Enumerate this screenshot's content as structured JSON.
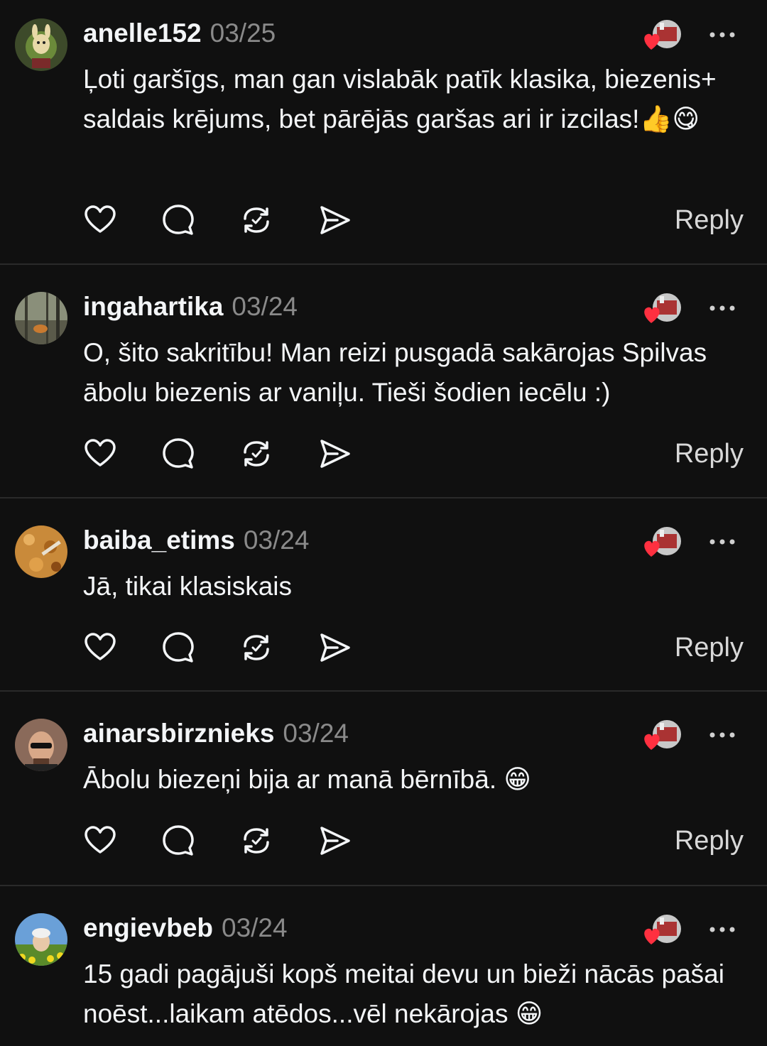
{
  "comments": [
    {
      "username": "anelle152",
      "date": "03/25",
      "text": "Ļoti garšīgs, man gan vislabāk patīk klasika, biezenis+ saldais krējums, bet pārējās garšas ari ir izcilas!👍😋",
      "avatar": "cartoon-character-avatar"
    },
    {
      "username": "ingahartika",
      "date": "03/24",
      "text": "O, šito sakritību! Man reizi pusgadā sakārojas Spilvas ābolu biezenis ar vaniļu. Tieši šodien iecēlu :)",
      "avatar": "forest-photo-avatar"
    },
    {
      "username": "baiba_etims",
      "date": "03/24",
      "text": "Jā, tikai klasiskais",
      "avatar": "pie-photo-avatar"
    },
    {
      "username": "ainarsbirznieks",
      "date": "03/24",
      "text": "Ābolu biezeņi bija ar manā bērnībā. 😁",
      "avatar": "man-sunglasses-avatar"
    },
    {
      "username": "engievbeb",
      "date": "03/24",
      "text": "15 gadi pagājuši kopš meitai devu un bieži nācās pašai noēst...laikam atēdos...vēl nekārojas 😁",
      "avatar": "dandelion-field-avatar"
    }
  ],
  "actions": {
    "reply_label": "Reply",
    "icons": [
      "heart-icon",
      "comment-icon",
      "repost-icon",
      "share-icon"
    ]
  },
  "colors": {
    "background": "#101010",
    "text": "#f3f5f7",
    "muted": "#8a8a8a",
    "divider": "#2a2a2a",
    "author_like_heart": "#ff3040"
  }
}
